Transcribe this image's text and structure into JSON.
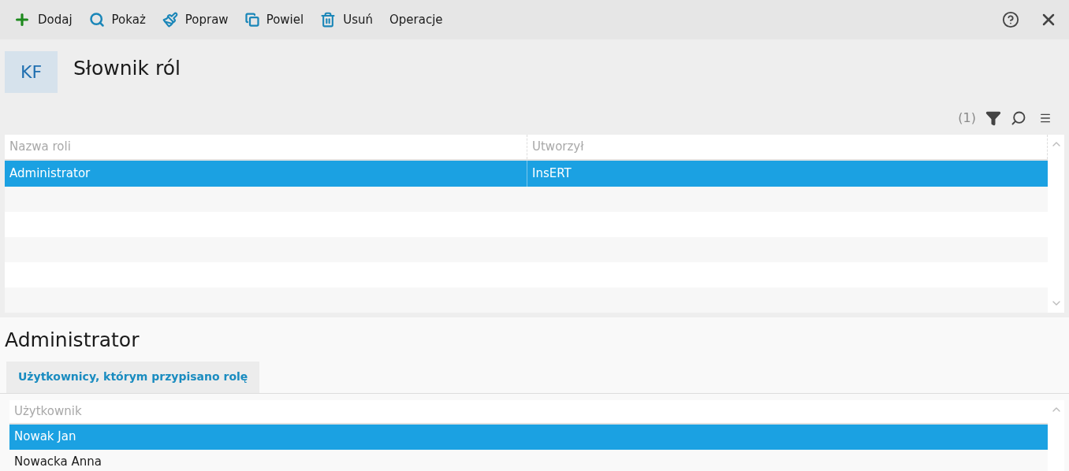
{
  "toolbar": [
    {
      "label": "Dodaj",
      "kind": "add"
    },
    {
      "label": "Pokaż",
      "kind": "show"
    },
    {
      "label": "Popraw",
      "kind": "edit"
    },
    {
      "label": "Powiel",
      "kind": "copy"
    },
    {
      "label": "Usuń",
      "kind": "delete"
    },
    {
      "label": "Operacje",
      "kind": "menu"
    }
  ],
  "header": {
    "badge": "KF",
    "title": "Słownik ról"
  },
  "list_tools": {
    "count": "(1)"
  },
  "roles_table": {
    "columns": [
      "Nazwa roli",
      "Utworzył"
    ],
    "rows": [
      {
        "cells": [
          "Administrator",
          "InsERT"
        ],
        "selected": true
      }
    ]
  },
  "detail": {
    "title": "Administrator",
    "tabs": [
      {
        "label": "Użytkownicy, którym przypisano rolę",
        "selected": true
      }
    ],
    "users_table": {
      "columns": [
        "Użytkownik"
      ],
      "rows": [
        {
          "cells": [
            "Nowak Jan"
          ],
          "selected": true
        },
        {
          "cells": [
            "Nowacka Anna"
          ],
          "selected": false
        }
      ]
    }
  }
}
